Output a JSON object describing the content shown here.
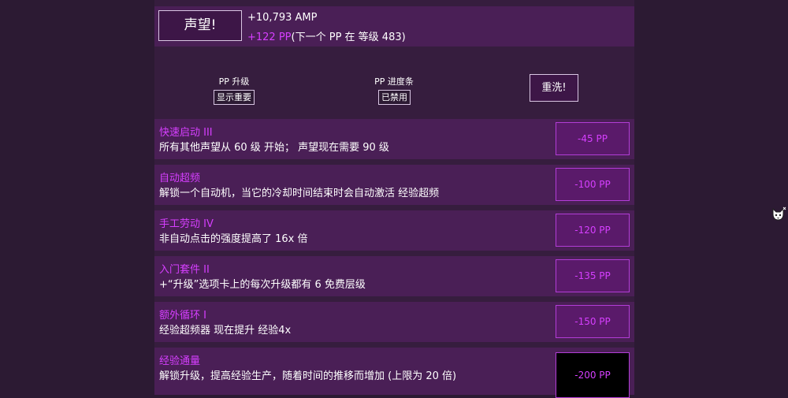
{
  "prestige": {
    "button_label": "声望!",
    "amp": "+10,793 AMP",
    "pp_gain": "+122 PP",
    "next_pp": "(下一个 PP 在 等级 483)"
  },
  "options": {
    "pp_upgrades_label": "PP 升级",
    "pp_upgrades_button": "显示重要",
    "pp_progress_label": "PP 进度条",
    "pp_progress_button": "已禁用",
    "respec_label": "重洗!"
  },
  "upgrades": [
    {
      "title": "快速启动 III",
      "desc": "所有其他声望从 60 级 开始； 声望现在需要 90 级",
      "cost": "-45 PP"
    },
    {
      "title": "自动超频",
      "desc": "解锁一个自动机，当它的冷却时间结束时会自动激活 经验超频",
      "cost": "-100 PP"
    },
    {
      "title": "手工劳动 IV",
      "desc": "非自动点击的强度提高了 16x 倍",
      "cost": "-120 PP"
    },
    {
      "title": "入门套件 II",
      "desc": "+“升级”选项卡上的每次升级都有 6 免费层级",
      "cost": "-135 PP"
    },
    {
      "title": "额外循环 I",
      "desc": "经验超频器 现在提升 经验4x",
      "cost": "-150 PP"
    },
    {
      "title": "经验通量",
      "desc": "解锁升级，提高经验生产，随着时间的推移而增加 (上限为 20 倍)",
      "cost": "-200 PP"
    }
  ],
  "colors": {
    "background": "#2c1a33",
    "panel": "#4a1f56",
    "accent": "#d63fff"
  },
  "side_icon": "cat-icon"
}
